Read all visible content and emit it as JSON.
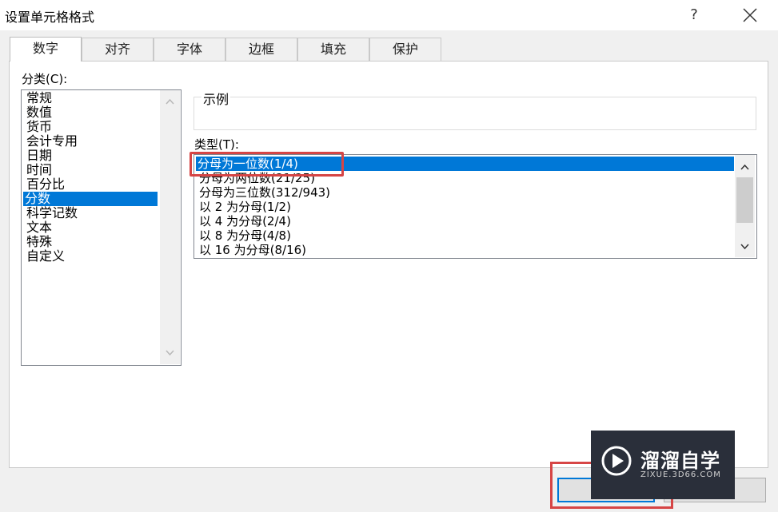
{
  "dialog": {
    "title": "设置单元格格式",
    "help_glyph": "?"
  },
  "tabs": [
    {
      "label": "数字"
    },
    {
      "label": "对齐"
    },
    {
      "label": "字体"
    },
    {
      "label": "边框"
    },
    {
      "label": "填充"
    },
    {
      "label": "保护"
    }
  ],
  "category": {
    "label": "分类(C):",
    "items": [
      "常规",
      "数值",
      "货币",
      "会计专用",
      "日期",
      "时间",
      "百分比",
      "分数",
      "科学记数",
      "文本",
      "特殊",
      "自定义"
    ],
    "selected": "分数"
  },
  "sample": {
    "label": "示例"
  },
  "type": {
    "label": "类型(T):",
    "items": [
      "分母为一位数(1/4)",
      "分母为两位数(21/25)",
      "分母为三位数(312/943)",
      "以 2 为分母(1/2)",
      "以 4 为分母(2/4)",
      "以 8 为分母(4/8)",
      "以 16 为分母(8/16)"
    ],
    "selected": "分母为一位数(1/4)"
  },
  "watermark": {
    "brand": "溜溜自学",
    "url": "ZIXUE.3D66.COM"
  },
  "colors": {
    "selection": "#0078d7",
    "highlight_annotation": "#d64545"
  },
  "icons": {
    "close": "close-icon",
    "scroll_up": "chevron-up-icon",
    "scroll_down": "chevron-down-icon",
    "play": "play-icon"
  }
}
